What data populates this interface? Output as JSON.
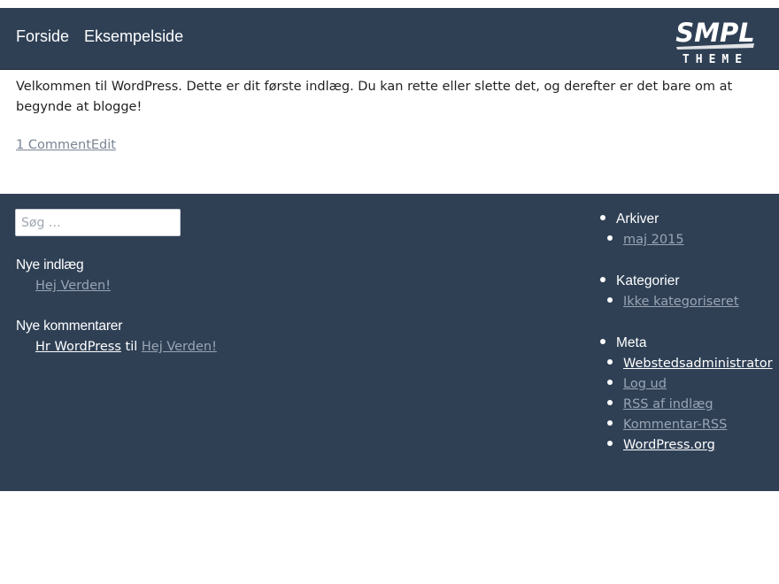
{
  "header": {
    "nav": [
      {
        "label": "Forside"
      },
      {
        "label": "Eksempelside"
      }
    ],
    "logo": {
      "line1": "SMPL",
      "line2": "THEME"
    }
  },
  "post": {
    "text": "Velkommen til WordPress. Dette er dit første indlæg. Du kan rette eller slette det, og derefter er det bare om at begynde at blogge!",
    "comments_link": "1 Comment",
    "edit_link": "Edit"
  },
  "footer": {
    "search": {
      "placeholder": "Søg …"
    },
    "recent_posts": {
      "title": "Nye indlæg",
      "items": [
        "Hej Verden!"
      ]
    },
    "recent_comments": {
      "title": "Nye kommentarer",
      "author": "Hr WordPress",
      "connector": "til",
      "post": "Hej Verden!"
    },
    "archives": {
      "title": "Arkiver",
      "items": [
        "maj 2015"
      ]
    },
    "categories": {
      "title": "Kategorier",
      "items": [
        "Ikke kategoriseret"
      ]
    },
    "meta": {
      "title": "Meta",
      "items": [
        "Webstedsadministrator",
        "Log ud",
        "RSS af indlæg",
        "Kommentar-RSS",
        "WordPress.org"
      ]
    }
  },
  "colors": {
    "header_bg": "#2f4055",
    "footer_bg": "#2f4055",
    "link_muted": "#9aa5b4",
    "text_dark": "#222222"
  }
}
